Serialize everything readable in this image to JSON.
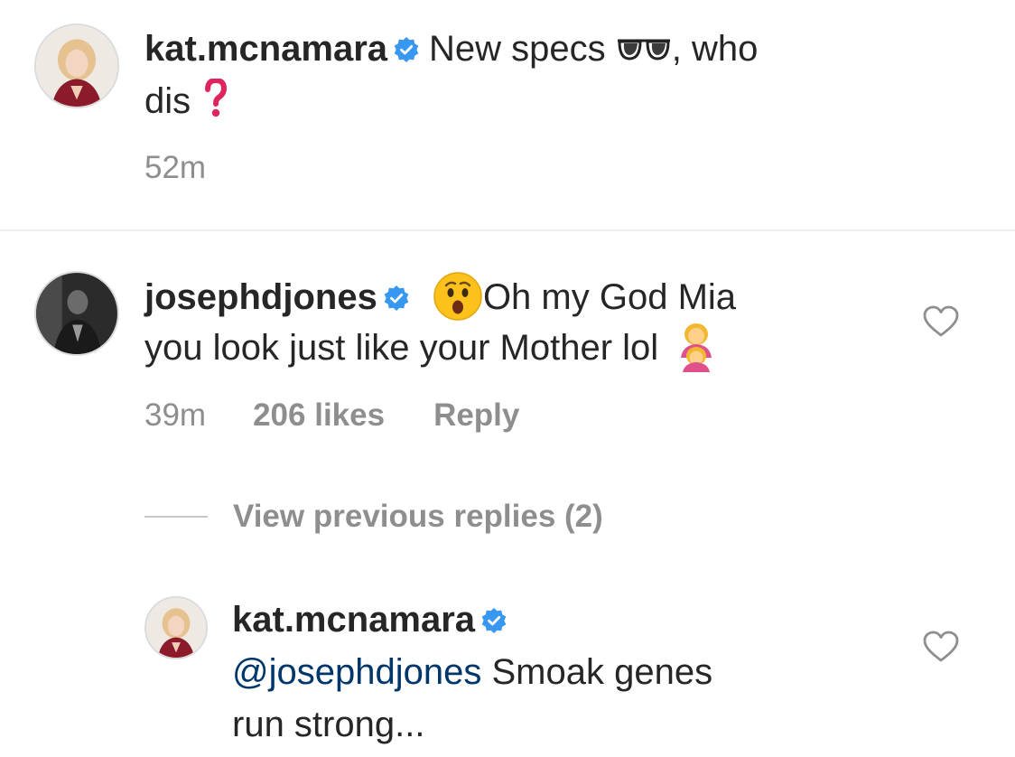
{
  "caption": {
    "username": "kat.mcnamara",
    "text_line1": "New specs",
    "text_line1_end": ", who",
    "text_line2": "dis",
    "time": "52m"
  },
  "comment": {
    "username": "josephdjones",
    "text_line1": "Oh my God Mia",
    "text_line2": "you look just like your Mother lol",
    "time": "39m",
    "likes": "206 likes",
    "reply_label": "Reply"
  },
  "replies_toggle": {
    "label": "View previous replies (2)"
  },
  "reply": {
    "username": "kat.mcnamara",
    "mention": "@josephdjones",
    "text_line1": "Smoak genes",
    "text_line2": "run strong..."
  },
  "colors": {
    "verified_blue": "#3897f0",
    "mention_blue": "#00376b",
    "muted_gray": "#8e8e8e",
    "question_red": "#e0245e"
  },
  "icons": {
    "verified": "verified-badge-icon",
    "heart": "heart-outline-icon",
    "glasses": "sunglasses-emoji",
    "question": "red-question-mark-emoji",
    "surprised": "hushed-face-emoji",
    "woman_girl": "woman-and-girl-emoji"
  }
}
